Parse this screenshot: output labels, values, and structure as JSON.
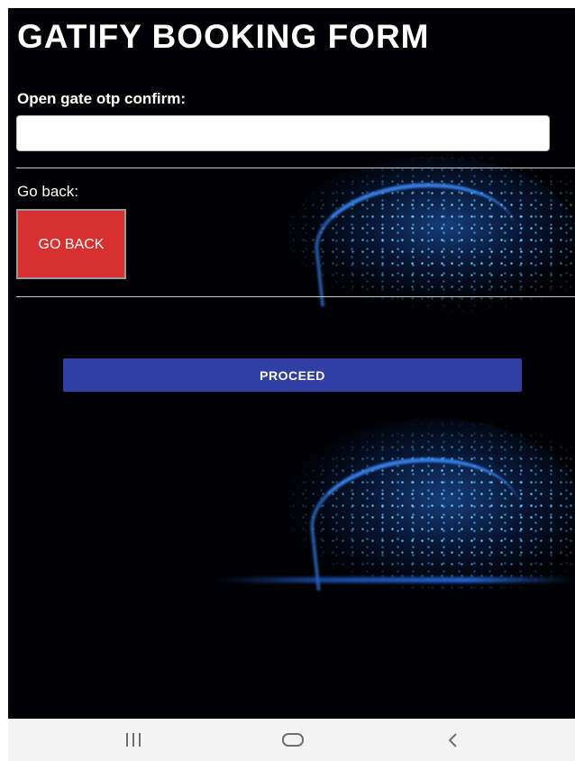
{
  "app": {
    "title": "GATIFY BOOKING FORM"
  },
  "otp": {
    "label": "Open gate otp confirm:",
    "value": "",
    "placeholder": ""
  },
  "back": {
    "label": "Go back:",
    "button_label": "GO BACK",
    "button_color": "#d63030"
  },
  "proceed": {
    "label": "PROCEED",
    "button_color": "#2f3fa3"
  },
  "navbar": {
    "recents_icon": "recents-icon",
    "home_icon": "home-icon",
    "back_icon": "back-icon",
    "back_glyph": "<"
  },
  "colors": {
    "background": "#010103",
    "text": "#ffffff",
    "navbar": "#f4f4f4"
  }
}
